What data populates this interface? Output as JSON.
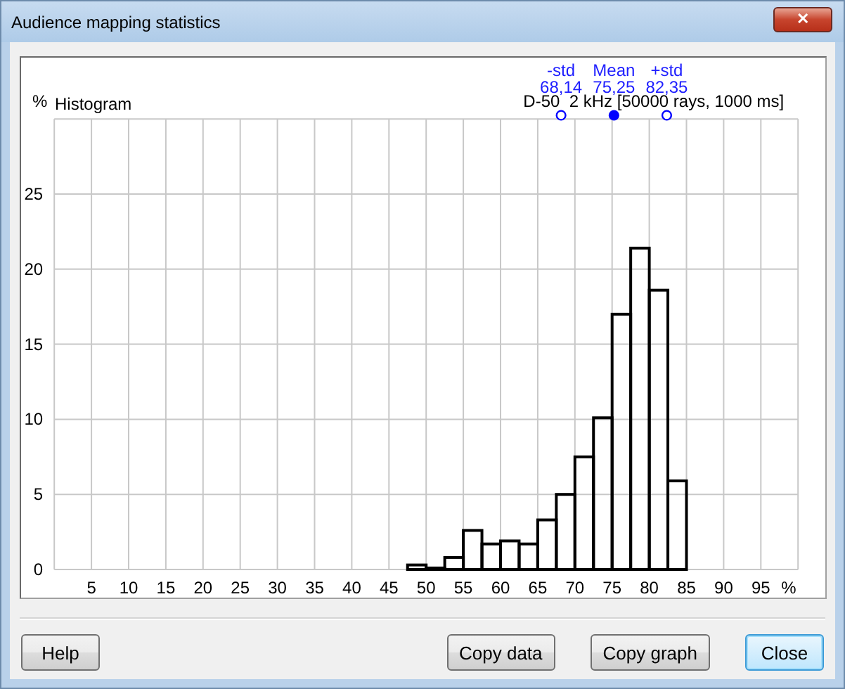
{
  "window": {
    "title": "Audience mapping statistics",
    "close": "✕"
  },
  "graph": {
    "subtitle": "D-50  2 kHz [50000 rays, 1000 ms]",
    "statistics": [
      {
        "label": "-std",
        "value": "68,14",
        "filled": false
      },
      {
        "label": "Mean",
        "value": "75,25",
        "filled": true
      },
      {
        "label": "+std",
        "value": "82,35",
        "filled": false
      }
    ],
    "chart_data": {
      "type": "bar",
      "title": "Histogram",
      "xlabel": "%",
      "ylabel": "%",
      "x": [
        48.75,
        51.25,
        53.75,
        56.25,
        58.75,
        61.25,
        63.75,
        66.25,
        68.75,
        71.25,
        73.75,
        76.25,
        78.75,
        81.25,
        83.75
      ],
      "series": [
        {
          "color": "#000000",
          "values": [
            0.3,
            0.1,
            0.8,
            2.6,
            1.7,
            1.9,
            1.7,
            3.3,
            5.0,
            7.5,
            10.1,
            17.0,
            21.4,
            18.6,
            5.9
          ]
        }
      ],
      "xlim": [
        0,
        100
      ],
      "ylim": [
        0,
        30
      ],
      "xticks": [
        5,
        10,
        15,
        20,
        25,
        30,
        35,
        40,
        45,
        50,
        55,
        60,
        65,
        70,
        75,
        80,
        85,
        90,
        95
      ],
      "yticks": [
        0,
        5,
        10,
        15,
        20,
        25
      ],
      "grid": true
    }
  },
  "buttons": [
    {
      "label": "Help",
      "default": false
    },
    {
      "label": "Copy data",
      "default": false
    },
    {
      "label": "Copy graph",
      "default": false
    },
    {
      "label": "Close",
      "default": true
    }
  ]
}
